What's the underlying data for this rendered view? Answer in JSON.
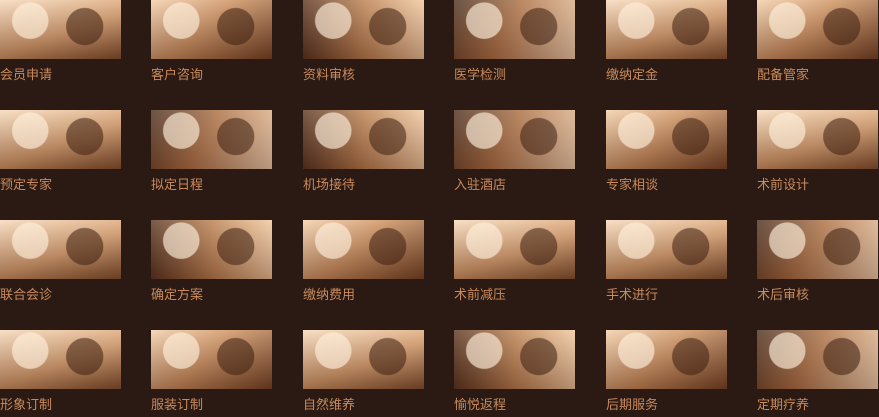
{
  "items": [
    {
      "label": "会员申请",
      "image": "signing-document-photo"
    },
    {
      "label": "客户咨询",
      "image": "consultation-photo"
    },
    {
      "label": "资料审核",
      "image": "reviewing-documents-photo"
    },
    {
      "label": "医学检测",
      "image": "medical-test-photo"
    },
    {
      "label": "缴纳定金",
      "image": "deposit-payment-photo"
    },
    {
      "label": "配备管家",
      "image": "butler-service-photo"
    },
    {
      "label": "预定专家",
      "image": "expert-booking-photo"
    },
    {
      "label": "拟定日程",
      "image": "schedule-planning-photo"
    },
    {
      "label": "机场接待",
      "image": "airport-reception-photo"
    },
    {
      "label": "入驻酒店",
      "image": "hotel-checkin-photo"
    },
    {
      "label": "专家相谈",
      "image": "expert-talk-photo"
    },
    {
      "label": "术前设计",
      "image": "pre-surgery-design-photo"
    },
    {
      "label": "联合会诊",
      "image": "joint-consultation-photo"
    },
    {
      "label": "确定方案",
      "image": "plan-confirmation-photo"
    },
    {
      "label": "缴纳费用",
      "image": "fee-payment-photo"
    },
    {
      "label": "术前减压",
      "image": "pre-surgery-relaxation-photo"
    },
    {
      "label": "手术进行",
      "image": "surgery-photo"
    },
    {
      "label": "术后审核",
      "image": "post-surgery-review-photo"
    },
    {
      "label": "形象订制",
      "image": "image-styling-photo"
    },
    {
      "label": "服装订制",
      "image": "clothing-customization-photo"
    },
    {
      "label": "自然维养",
      "image": "natural-care-photo"
    },
    {
      "label": "愉悦返程",
      "image": "return-flight-photo"
    },
    {
      "label": "后期服务",
      "image": "aftercare-service-photo"
    },
    {
      "label": "定期疗养",
      "image": "regular-recuperation-photo"
    }
  ]
}
